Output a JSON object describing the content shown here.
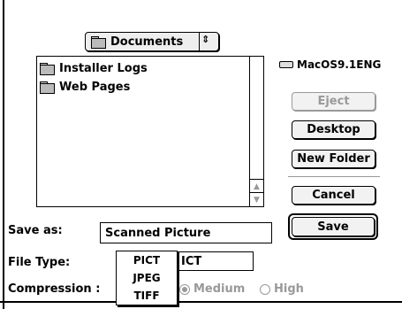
{
  "folder_popup": {
    "label": "Documents",
    "icon": "folder-icon",
    "arrows": "⇕"
  },
  "file_list": [
    {
      "name": "Installer Logs",
      "icon": "folder-icon"
    },
    {
      "name": "Web Pages",
      "icon": "folder-icon"
    }
  ],
  "volume": {
    "name": "MacOS9.1ENG",
    "icon": "disk-icon"
  },
  "buttons": {
    "eject": "Eject",
    "desktop": "Desktop",
    "new_folder": "New Folder",
    "cancel": "Cancel",
    "save": "Save"
  },
  "save_as": {
    "label": "Save as:",
    "value": "Scanned Picture"
  },
  "file_type": {
    "label": "File Type:",
    "visible_value": "ICT"
  },
  "file_type_menu": [
    "PICT",
    "JPEG",
    "TIFF"
  ],
  "compression": {
    "label": "Compression :",
    "options": [
      {
        "label": "Medium",
        "selected": true
      },
      {
        "label": "High",
        "selected": false
      }
    ]
  }
}
